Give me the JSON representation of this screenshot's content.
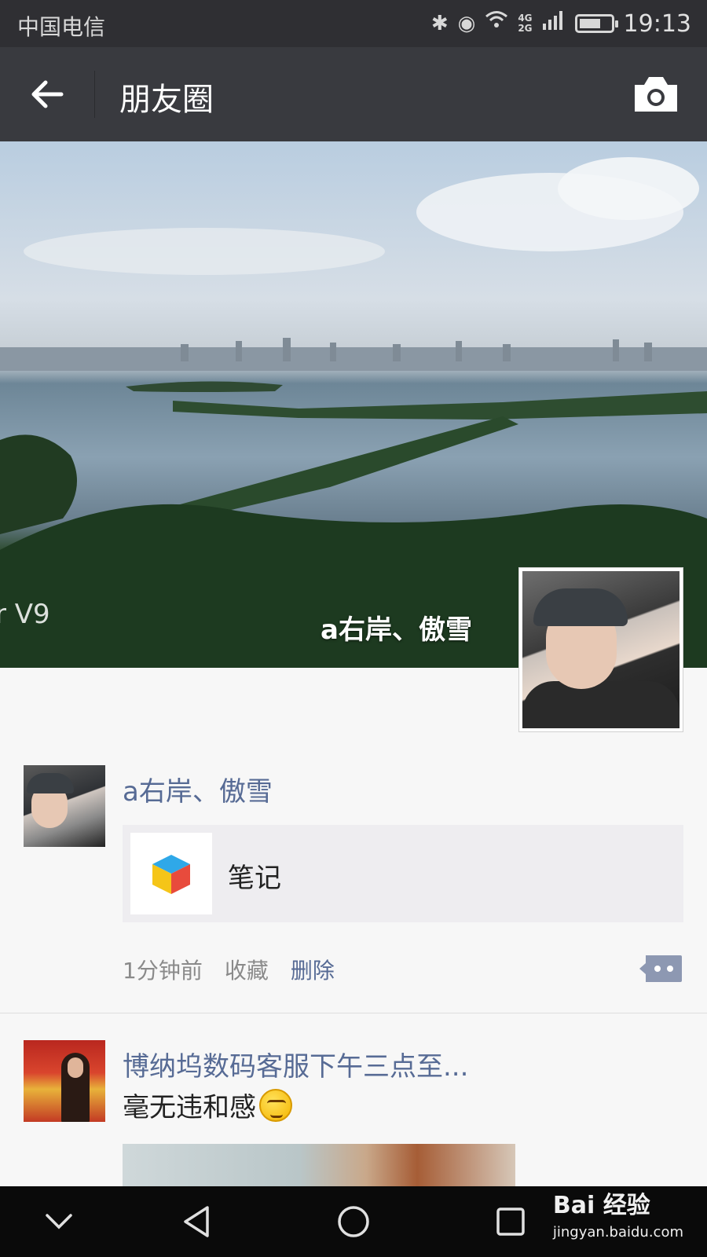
{
  "status_bar": {
    "carrier": "中国电信",
    "network": "4G\n2G",
    "time": "19:13"
  },
  "nav": {
    "title": "朋友圈"
  },
  "cover": {
    "user_name": "a右岸、傲雪",
    "watermark": "r V9"
  },
  "posts": [
    {
      "nickname": "a右岸、傲雪",
      "share_title": "笔记",
      "time_ago": "1分钟前",
      "favorite_label": "收藏",
      "delete_label": "删除"
    },
    {
      "nickname": "博纳坞数码客服下午三点至...",
      "text": "毫无违和感"
    }
  ],
  "footer_watermark": {
    "brand": "Bai 经验",
    "url": "jingyan.baidu.com"
  },
  "colors": {
    "accent_link": "#576b95",
    "nav_bg": "#393a3f",
    "status_bg": "#2f2f33"
  }
}
